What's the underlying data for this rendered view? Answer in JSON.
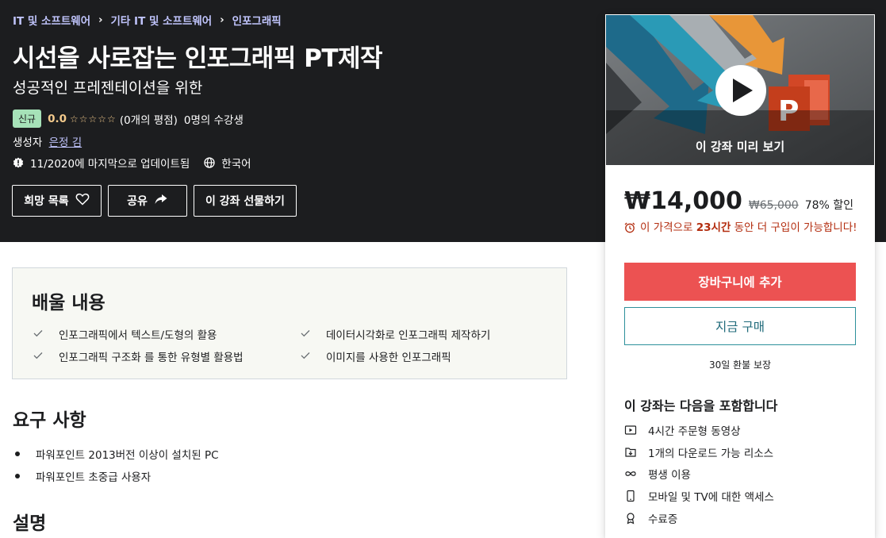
{
  "breadcrumb": [
    "IT 및 소프트웨어",
    "기타 IT 및 소프트웨어",
    "인포그래픽"
  ],
  "course": {
    "title": "시선을 사로잡는 인포그래픽 PT제작",
    "subtitle": "성공적인 프레젠테이션을 위한",
    "badge": "신규",
    "rating": "0.0",
    "rating_stars": "☆☆☆☆☆",
    "rating_count": "(0개의 평점)",
    "students": "0명의 수강생",
    "author_label": "생성자",
    "author_name": "은정 김",
    "updated": "11/2020에 마지막으로 업데이트됨",
    "language": "한국어"
  },
  "hero_buttons": {
    "wishlist": "희망 목록",
    "share": "공유",
    "gift": "이 강좌 선물하기"
  },
  "sidebar": {
    "preview_label": "이 강좌 미리 보기",
    "price_current": "₩14,000",
    "price_original": "₩65,000",
    "discount": "78% 할인",
    "timer_prefix": "이 가격으로",
    "timer_hours": "23시간",
    "timer_suffix": "동안 더 구입이 가능합니다!",
    "add_to_cart": "장바구니에 추가",
    "buy_now": "지금 구매",
    "guarantee": "30일 환불 보장",
    "includes_title": "이 강좌는 다음을 포함합니다",
    "includes": [
      {
        "icon": "video-icon",
        "label": "4시간 주문형 동영상"
      },
      {
        "icon": "download-file-icon",
        "label": "1개의 다운로드 가능 리소스"
      },
      {
        "icon": "infinity-icon",
        "label": "평생 이용"
      },
      {
        "icon": "mobile-icon",
        "label": "모바일 및 TV에 대한 액세스"
      },
      {
        "icon": "certificate-icon",
        "label": "수료증"
      }
    ]
  },
  "learn": {
    "title": "배울 내용",
    "items": [
      "인포그래픽에서 텍스트/도형의 활용",
      "데이터시각화로 인포그래픽 제작하기",
      "인포그래픽 구조화 를 통한 유형별 활용법",
      "이미지를 사용한 인포그래픽"
    ]
  },
  "requirements": {
    "title": "요구 사항",
    "items": [
      "파워포인트 2013버전 이상이 설치된 PC",
      "파워포인트 초중급 사용자"
    ]
  },
  "description": {
    "title": "설명"
  },
  "colors": {
    "hero_bg": "#1c1d1f",
    "cart": "#ec5252",
    "link": "#c0c4fc",
    "badge": "#a6e2b8",
    "timer": "#b32d0f"
  }
}
